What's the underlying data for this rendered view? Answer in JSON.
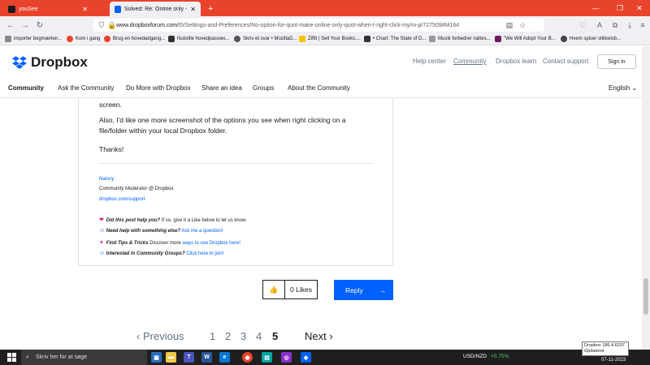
{
  "browser": {
    "tabs": [
      {
        "title": "youSee",
        "active": false
      },
      {
        "title": "Solved: Re: Online only - where",
        "active": true
      }
    ],
    "new_tab": "+",
    "url_host": "www.dropboxforum.com",
    "url_path": "/t5/Settings-and-Preferences/No-option-for-quot-make-online-only-quot-when-I-right-click-my/m-p/727509#M164",
    "bookmarks": [
      "importer bogmærker...",
      "Kom i gang",
      "Brug en hovedadgang...",
      "Nulstille hovedpasswo...",
      "Skriv et svar • MozillaD...",
      "Ziffit | Sell Your Books,...",
      "• Chart: The State of D...",
      "Musik forbedrer nattes...",
      "\"We Will Adopt Your B...",
      "Hvem spiser stikkelsb..."
    ]
  },
  "site": {
    "brand": "Dropbox",
    "top_links": [
      "Help center",
      "Community",
      "Dropbox learn",
      "Contact support"
    ],
    "signin": "Sign in",
    "community_nav": [
      "Community",
      "Ask the Community",
      "Do More with Dropbox",
      "Share an idea",
      "Groups",
      "About the Community"
    ],
    "language": "English",
    "colors": {
      "accent": "#0061fe",
      "browser_red": "#e8432b"
    }
  },
  "post": {
    "line1": "screen.",
    "line2a": "Also, I'd like one more screenshot of the options you see when right clicking on a",
    "line2b": "file/folder within your local Dropbox folder.",
    "thanks": "Thanks!",
    "sig_name": "Nancy",
    "sig_role": "Community Moderator @ Dropbox",
    "sig_link": "dropbox.com/support",
    "sig_lines": [
      {
        "icon": "heart-icon",
        "glyph": "❤",
        "em": "Did this post help you?",
        "text": " If so, give it a Like below to let us know.",
        "link": ""
      },
      {
        "icon": "help-icon",
        "glyph": "☺",
        "em": "Need help with something else?",
        "text": " ",
        "link": "Ask me a question!"
      },
      {
        "icon": "pin-icon",
        "glyph": "📌",
        "em": "Find Tips & Tricks",
        "text": " Discover more ",
        "link": "ways to use Dropbox here!"
      },
      {
        "icon": "group-icon",
        "glyph": "☺",
        "em": "Interested in Community Groups?",
        "text": " ",
        "link": "Click here to join!"
      }
    ]
  },
  "actions": {
    "likes": "0 Likes",
    "reply": "Reply"
  },
  "pagination": {
    "previous": "Previous",
    "pages": [
      "1",
      "2",
      "3",
      "4",
      "5"
    ],
    "current": "5",
    "next": "Next"
  },
  "tooltip": {
    "line1": "Dropbox 186.4.6207",
    "line2": "Opdateret"
  },
  "taskbar": {
    "search_placeholder": "Skriv her for at søge",
    "ticker": "USD/NZD",
    "ticker_change": "+0.75%",
    "date": "07-11-2023"
  }
}
